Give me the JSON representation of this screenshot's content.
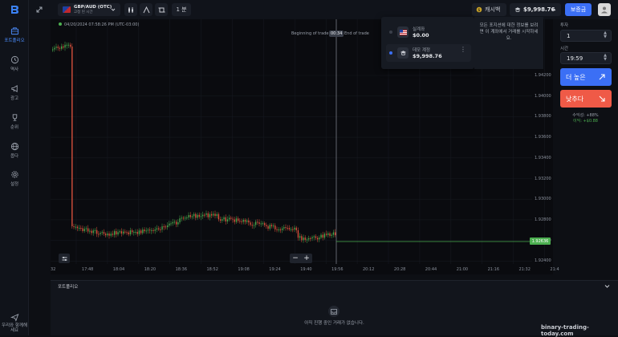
{
  "sidebar": {
    "items": [
      {
        "label": "포트폴리오",
        "icon": "briefcase-icon"
      },
      {
        "label": "역사",
        "icon": "clock-icon"
      },
      {
        "label": "광고",
        "icon": "megaphone-icon"
      },
      {
        "label": "순위",
        "icon": "trophy-icon"
      },
      {
        "label": "옵다",
        "icon": "globe-icon"
      },
      {
        "label": "설정",
        "icon": "gear-icon"
      }
    ],
    "help_label": "우리와 함께해 세요"
  },
  "header": {
    "asset_name": "GBP/AUD (OTC)",
    "asset_sub": "고정 된 시간",
    "timeframe": "1 분",
    "cashback_label": "캐시백",
    "balance": "$9,998.76",
    "deposit_label": "보증금"
  },
  "chart": {
    "timestamp": "04/20/2024  07:58:26 PM  (UTC-03:00)",
    "beginning_label": "Beginning of trade",
    "countdown": "00:34",
    "end_label": "End of trade",
    "current_price": "1.92636",
    "y_ticks": [
      "1.94200",
      "1.94000",
      "1.93800",
      "1.93600",
      "1.93400",
      "1.93200",
      "1.93000",
      "1.92800",
      "1.92600",
      "1.92400"
    ],
    "x_ticks": [
      "32",
      "17:48",
      "18:04",
      "18:20",
      "18:36",
      "18:52",
      "19:08",
      "19:24",
      "19:40",
      "19:56",
      "20:12",
      "20:28",
      "20:44",
      "21:00",
      "21:16",
      "21:32",
      "21:4"
    ]
  },
  "accounts_dropdown": {
    "real": {
      "label": "실계좌",
      "value": "$0.00"
    },
    "demo": {
      "label": "데모 계정",
      "value": "$9,998.76"
    }
  },
  "tooltip_text": "모든 포지션에 대한 정보를 보려면 이 계좌에서 거래를 시작하세요.",
  "right_panel": {
    "amount_label": "투자",
    "amount_value": "1",
    "time_label": "시간",
    "time_value": "19:59",
    "higher_label": "더 높은",
    "lower_label": "낮추다",
    "profit_label": "수익성: +88%",
    "profit_value": "이익: +$0.88"
  },
  "portfolio": {
    "title": "포트폴리오",
    "empty_text": "아직 진행 중인 거래가 없습니다."
  },
  "watermark": "binary-trading-today.com",
  "colors": {
    "accent": "#3b6ff5",
    "green": "#4caf50",
    "red": "#e4553f",
    "lower_btn": "#ef5a47"
  }
}
